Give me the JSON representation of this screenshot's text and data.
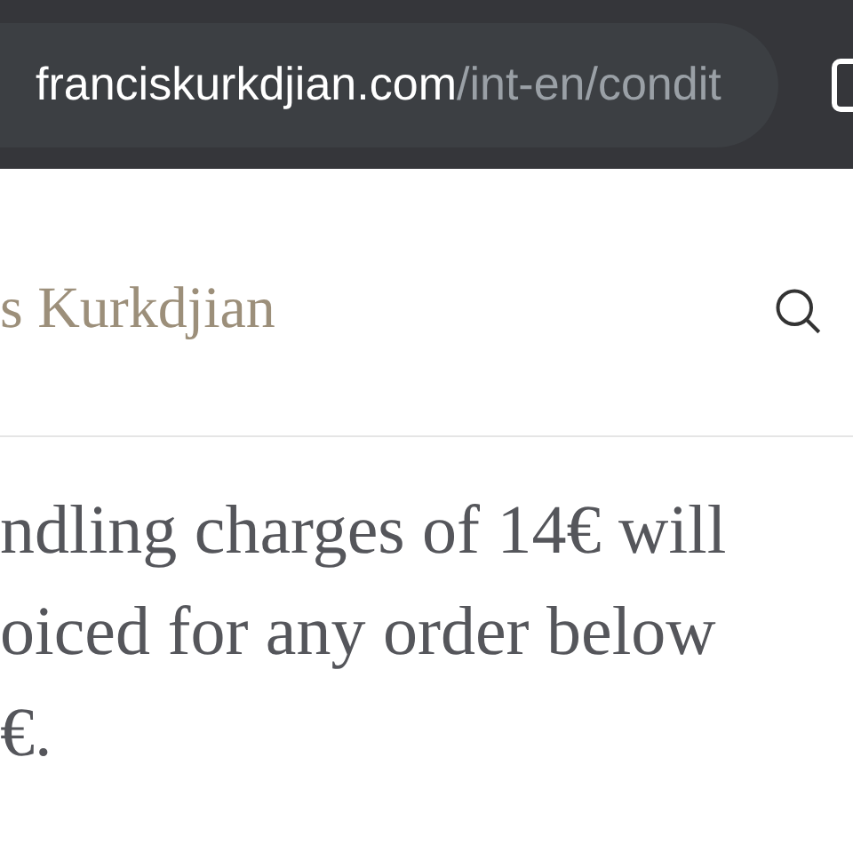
{
  "address_bar": {
    "domain": "franciskurkdjian.com",
    "path": "/int-en/condit"
  },
  "header": {
    "logo": "s Kurkdjian"
  },
  "body": {
    "lines": [
      "ndling charges of 14€ will",
      "oiced for any order below",
      "€."
    ]
  }
}
